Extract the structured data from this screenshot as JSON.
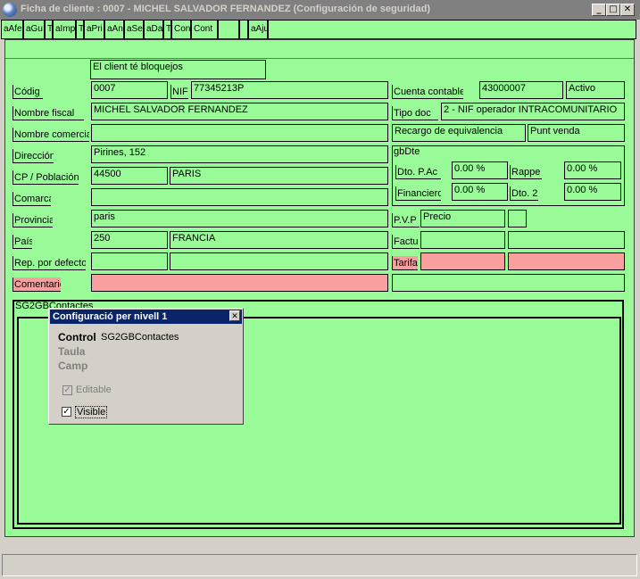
{
  "window": {
    "title": "Ficha de cliente :  0007 - MICHEL SALVADOR FERNANDEZ (Configuración de seguridad)",
    "minimize": "_",
    "maximize": "□",
    "close": "✕"
  },
  "toolbar": {
    "items": [
      "aAfe",
      "aGu",
      "T",
      "aImp",
      "T",
      "aPri",
      "aAn",
      "aSe",
      "aDa",
      "T",
      "Con",
      "Cont",
      "",
      "",
      "aAju"
    ]
  },
  "form": {
    "header_note": "El client té bloquejos",
    "labels": {
      "codigo": "Códig",
      "nif": "NIF",
      "nombre_fiscal": "Nombre fiscal",
      "nombre_comercial": "Nombre comercial",
      "direccion": "Dirección",
      "cp_poblacion": "CP / Población",
      "comarca": "Comarca",
      "provincia": "Provincia",
      "pais": "País",
      "rep_defecto": "Rep. por defecto",
      "comentario": "Comentario",
      "cuenta_contable": "Cuenta contable",
      "tipo_doc": "Tipo doc",
      "gbdte": "gbDte",
      "dto_pac": "Dto. P.Ac",
      "rappel": "Rappe",
      "financiero": "Financiero",
      "dto2": "Dto. 2",
      "pvp": "P.V.P",
      "factura": "Factu",
      "tarifa": "Tarifa"
    },
    "values": {
      "codigo": "0007",
      "nif": "77345213P",
      "nombre_fiscal": "MICHEL SALVADOR FERNANDEZ",
      "nombre_comercial": "",
      "direccion": "Pirines, 152",
      "cp": "44500",
      "poblacion": "PARIS",
      "comarca": "",
      "provincia": "paris",
      "pais_code": "250",
      "pais_name": "FRANCIA",
      "rep1": "",
      "rep2": "",
      "comentario": "",
      "cuenta_contable": "43000007",
      "estado": "Activo",
      "tipo_doc": "2 - NIF operador INTRACOMUNITARIO",
      "recargo": "Recargo de equivalencia",
      "punt_venda": "Punt venda",
      "dto_pac": "0.00 %",
      "rappel": "0.00 %",
      "financiero": "0.00 %",
      "dto2": "0.00 %",
      "pvp": "Precio",
      "pvp_extra": "",
      "factura1": "",
      "factura2": "",
      "tarifa1": "",
      "tarifa2": "",
      "extra_right": ""
    }
  },
  "grid": {
    "caption": "SG2GBContactes"
  },
  "popup": {
    "title": "Configuració per nivell 1",
    "close": "✕",
    "control_label": "Control",
    "control_value": "SG2GBContactes",
    "taula_label": "Taula",
    "camp_label": "Camp",
    "editable_label": "Editable",
    "editable_checked": true,
    "visible_label": "Visible",
    "visible_checked": true
  },
  "status": {
    "text": ""
  }
}
